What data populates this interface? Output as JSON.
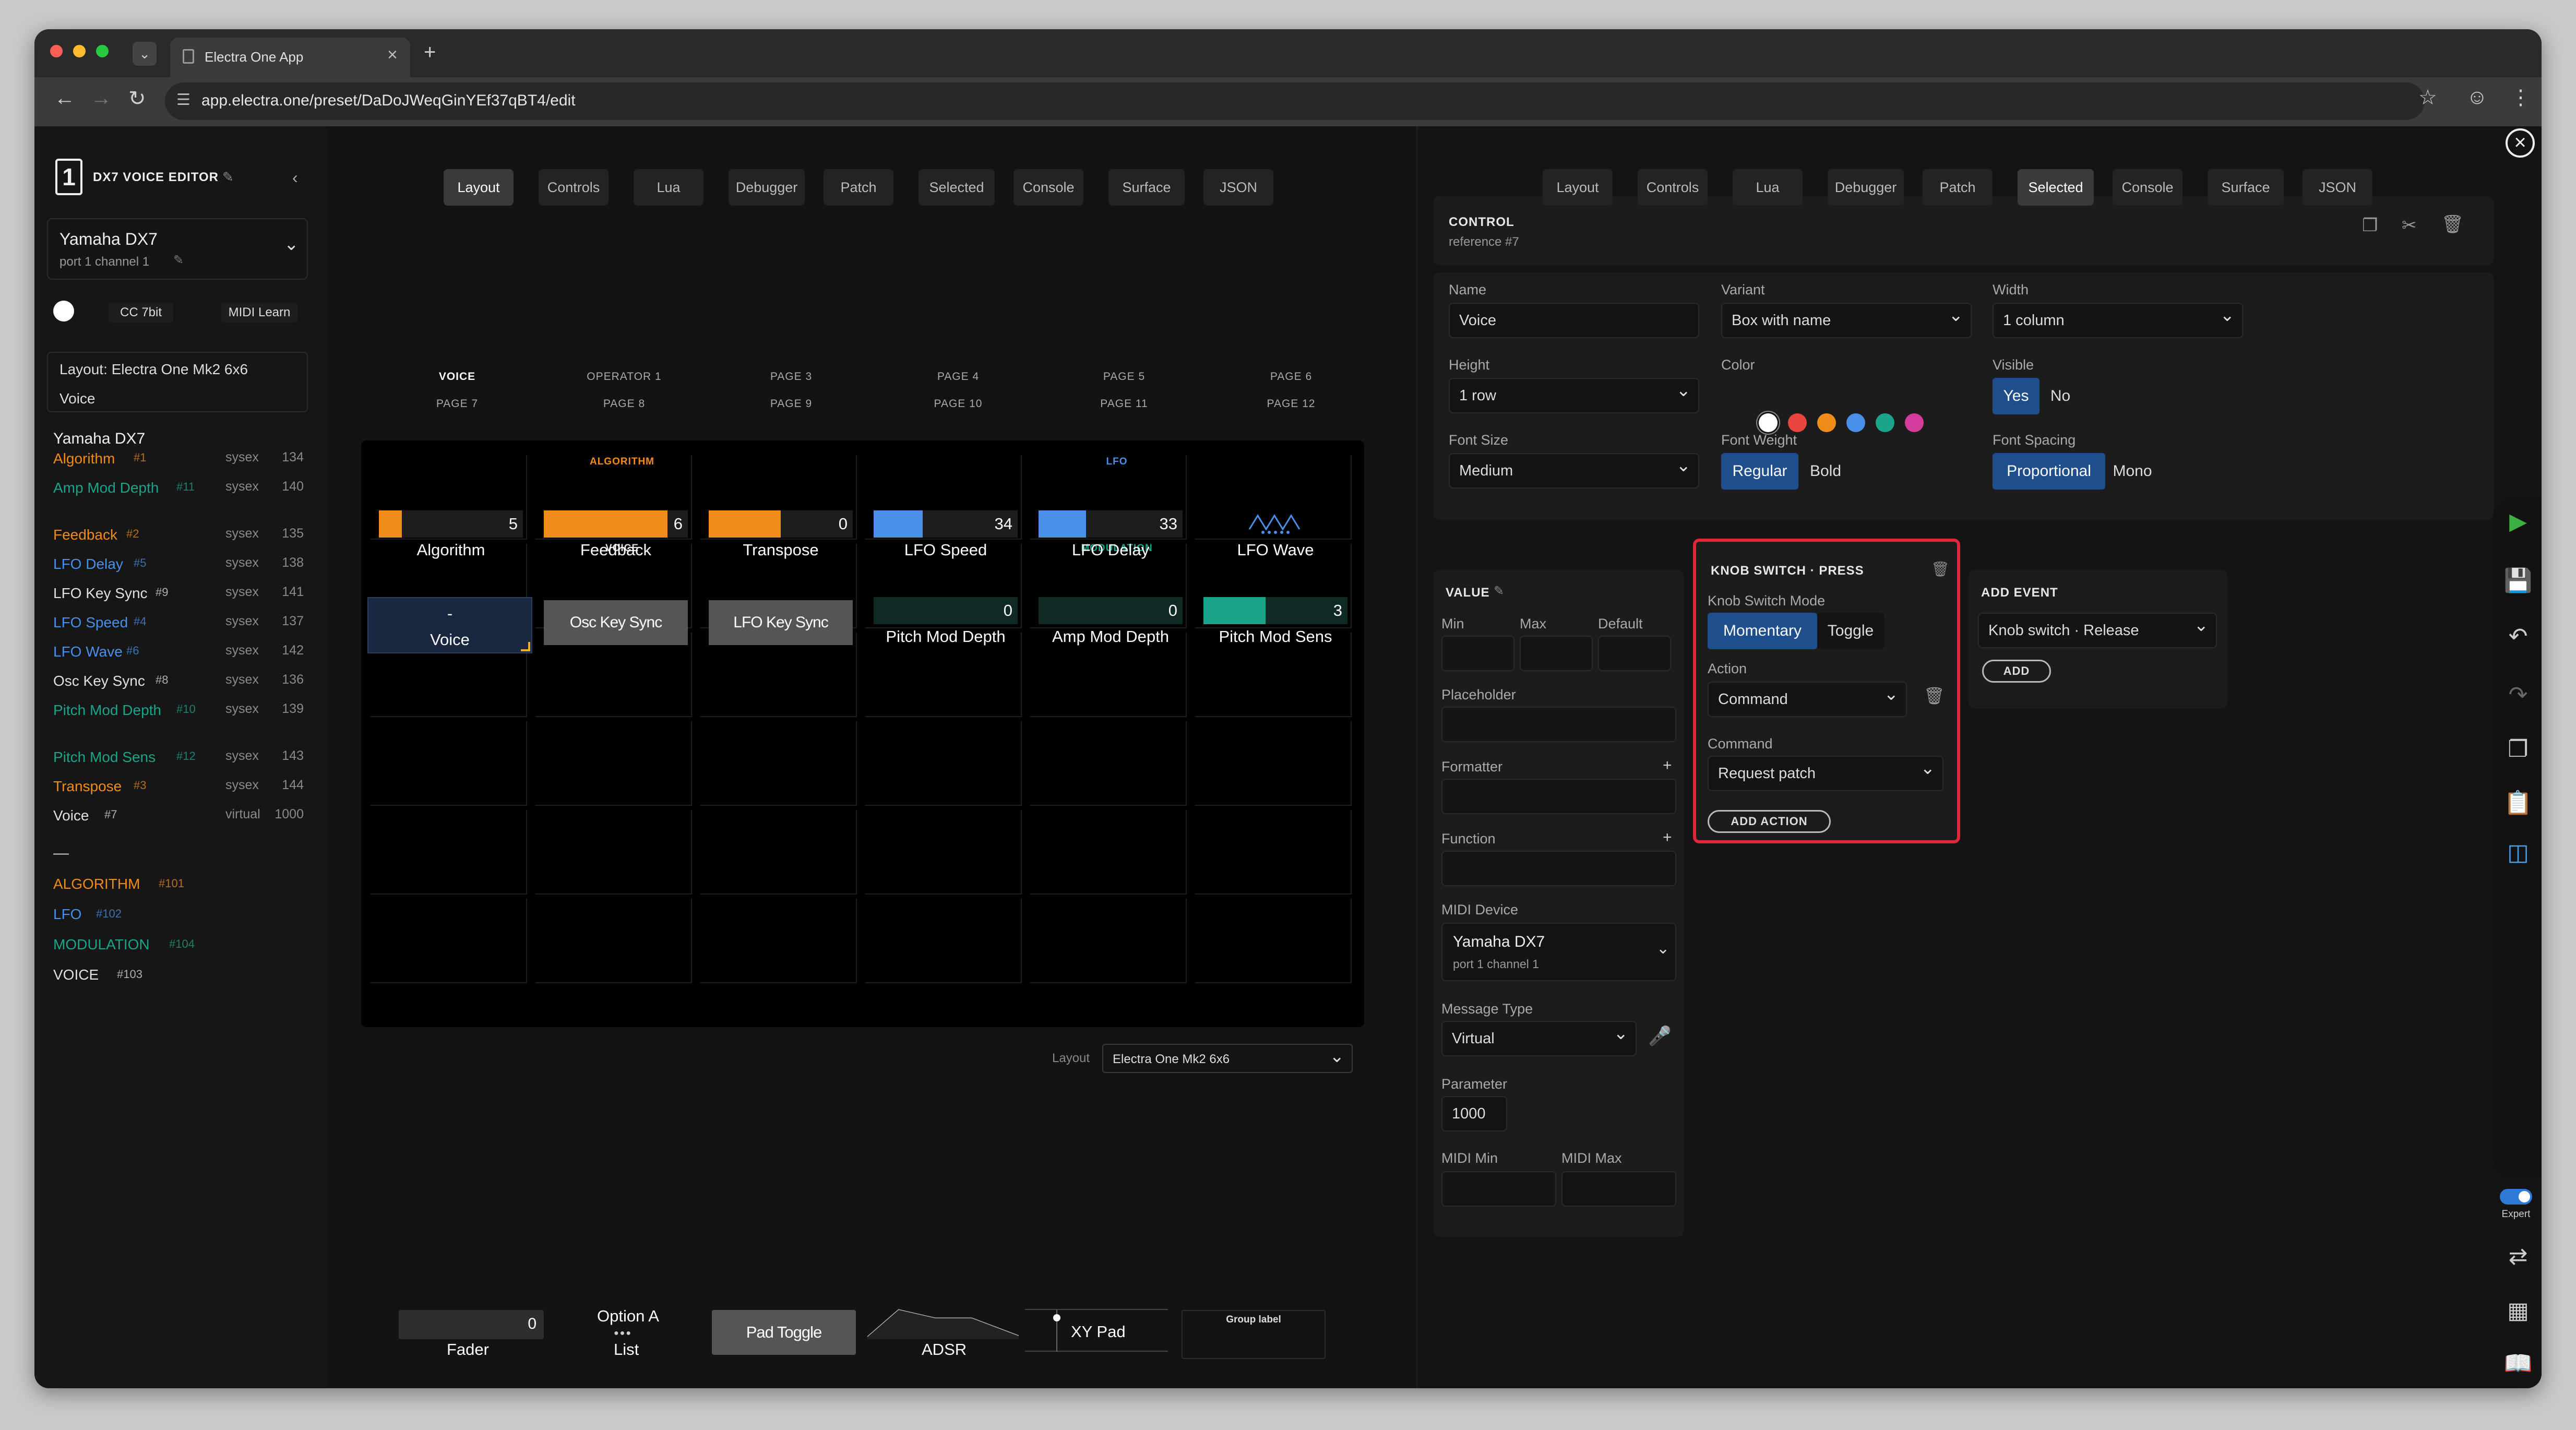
{
  "browser": {
    "tab_title": "Electra One App",
    "url": "app.electra.one/preset/DaDoJWeqGinYEf37qBT4/edit",
    "new_tab": "+",
    "close_tab": "×"
  },
  "sidebar": {
    "logo_char": "1",
    "preset_title": "DX7 VOICE EDITOR",
    "device_name": "Yamaha DX7",
    "device_port": "port 1 channel 1",
    "cc_label": "CC 7bit",
    "midi_learn": "MIDI Learn",
    "layout_info": "Layout: Electra One Mk2 6x6",
    "layout_selected": "Voice",
    "group_title": "Yamaha DX7",
    "parameters": [
      {
        "name": "Algorithm",
        "id": "#1",
        "type": "sysex",
        "number": "134",
        "color": "#f08c1a"
      },
      {
        "name": "Amp Mod Depth",
        "id": "#11",
        "type": "sysex",
        "number": "140",
        "color": "#1aa58a"
      },
      {
        "name": "Feedback",
        "id": "#2",
        "type": "sysex",
        "number": "135",
        "color": "#f08c1a"
      },
      {
        "name": "LFO Delay",
        "id": "#5",
        "type": "sysex",
        "number": "138",
        "color": "#4a8fe8"
      },
      {
        "name": "LFO Key Sync",
        "id": "#9",
        "type": "sysex",
        "number": "141",
        "color": "#e0e0e0"
      },
      {
        "name": "LFO Speed",
        "id": "#4",
        "type": "sysex",
        "number": "137",
        "color": "#4a8fe8"
      },
      {
        "name": "LFO Wave",
        "id": "#6",
        "type": "sysex",
        "number": "142",
        "color": "#4a8fe8"
      },
      {
        "name": "Osc Key Sync",
        "id": "#8",
        "type": "sysex",
        "number": "136",
        "color": "#e0e0e0"
      },
      {
        "name": "Pitch Mod Depth",
        "id": "#10",
        "type": "sysex",
        "number": "139",
        "color": "#1aa58a"
      },
      {
        "name": "Pitch Mod Sens",
        "id": "#12",
        "type": "sysex",
        "number": "143",
        "color": "#1aa58a"
      },
      {
        "name": "Transpose",
        "id": "#3",
        "type": "sysex",
        "number": "144",
        "color": "#f08c1a"
      },
      {
        "name": "Voice",
        "id": "#7",
        "type": "virtual",
        "number": "1000",
        "color": "#e0e0e0"
      }
    ],
    "separator": "—",
    "groups": [
      {
        "name": "ALGORITHM",
        "id": "#101",
        "color": "#f08c1a"
      },
      {
        "name": "LFO",
        "id": "#102",
        "color": "#4a8fe8"
      },
      {
        "name": "MODULATION",
        "id": "#104",
        "color": "#1aa58a"
      },
      {
        "name": "VOICE",
        "id": "#103",
        "color": "#e0e0e0"
      }
    ]
  },
  "tabs": [
    "Layout",
    "Controls",
    "Lua",
    "Debugger",
    "Patch",
    "Selected",
    "Console",
    "Surface",
    "JSON"
  ],
  "pages": {
    "row1": [
      "VOICE",
      "OPERATOR 1",
      "PAGE 3",
      "PAGE 4",
      "PAGE 5",
      "PAGE 6"
    ],
    "row2": [
      "PAGE 7",
      "PAGE 8",
      "PAGE 9",
      "PAGE 10",
      "PAGE 11",
      "PAGE 12"
    ]
  },
  "grid": {
    "group_labels": {
      "algorithm": "ALGORITHM",
      "lfo": "LFO",
      "voice": "VOICE",
      "modulation": "MODULATION"
    },
    "row1": [
      {
        "name": "Algorithm",
        "value": "5",
        "fill": 0.16,
        "color": "#f08c1a"
      },
      {
        "name": "Feedback",
        "value": "6",
        "fill": 0.86,
        "color": "#f08c1a"
      },
      {
        "name": "Transpose",
        "value": "0",
        "fill": 0.5,
        "color": "#f08c1a"
      },
      {
        "name": "LFO Speed",
        "value": "34",
        "fill": 0.34,
        "color": "#4a8fe8"
      },
      {
        "name": "LFO Delay",
        "value": "33",
        "fill": 0.33,
        "color": "#4a8fe8"
      },
      {
        "name": "LFO Wave",
        "value": "",
        "fill": 0,
        "color": "#4a8fe8"
      }
    ],
    "row2": [
      {
        "name": "Voice",
        "value": "-"
      },
      {
        "name": "Osc Key Sync",
        "value": ""
      },
      {
        "name": "LFO Key Sync",
        "value": ""
      },
      {
        "name": "Pitch Mod Depth",
        "value": "0",
        "fill": 0,
        "color": "#1aa58a"
      },
      {
        "name": "Amp Mod Depth",
        "value": "0",
        "fill": 0,
        "color": "#1aa58a"
      },
      {
        "name": "Pitch Mod Sens",
        "value": "3",
        "fill": 0.43,
        "color": "#1aa58a"
      }
    ]
  },
  "layout_select": {
    "label": "Layout",
    "value": "Electra One Mk2 6x6"
  },
  "palette": {
    "fader": {
      "label": "Fader",
      "value": "0"
    },
    "list": {
      "label": "List",
      "value": "Option A"
    },
    "pad": {
      "label": "Pad Toggle"
    },
    "adsr": {
      "label": "ADSR"
    },
    "xy": {
      "label": "XY Pad"
    },
    "group": {
      "label": "Group label"
    }
  },
  "right": {
    "control_title": "CONTROL",
    "control_ref": "reference #7",
    "name_label": "Name",
    "name_value": "Voice",
    "variant_label": "Variant",
    "variant_value": "Box with name",
    "width_label": "Width",
    "width_value": "1 column",
    "height_label": "Height",
    "height_value": "1 row",
    "color_label": "Color",
    "colors": [
      "#ffffff",
      "#e8453c",
      "#f08c1a",
      "#4a8fe8",
      "#1aa58a",
      "#d43c9c"
    ],
    "visible_label": "Visible",
    "visible_yes": "Yes",
    "visible_no": "No",
    "fontsize_label": "Font Size",
    "fontsize_value": "Medium",
    "fontweight_label": "Font Weight",
    "fw_regular": "Regular",
    "fw_bold": "Bold",
    "fontspacing_label": "Font Spacing",
    "fs_prop": "Proportional",
    "fs_mono": "Mono",
    "value_title": "VALUE",
    "min_label": "Min",
    "max_label": "Max",
    "default_label": "Default",
    "placeholder_label": "Placeholder",
    "formatter_label": "Formatter",
    "function_label": "Function",
    "plus": "+",
    "mididevice_label": "MIDI Device",
    "mididevice_value": "Yamaha DX7",
    "mididevice_port": "port 1 channel 1",
    "msgtype_label": "Message Type",
    "msgtype_value": "Virtual",
    "param_label": "Parameter",
    "param_value": "1000",
    "midimin_label": "MIDI Min",
    "midimax_label": "MIDI Max",
    "knob_title": "KNOB SWITCH · PRESS",
    "knobmode_label": "Knob Switch Mode",
    "mode_momentary": "Momentary",
    "mode_toggle": "Toggle",
    "action_label": "Action",
    "action_value": "Command",
    "command_label": "Command",
    "command_value": "Request patch",
    "add_action": "ADD ACTION",
    "addevent_title": "ADD EVENT",
    "addevent_value": "Knob switch · Release",
    "add_btn": "ADD",
    "expert_label": "Expert"
  }
}
